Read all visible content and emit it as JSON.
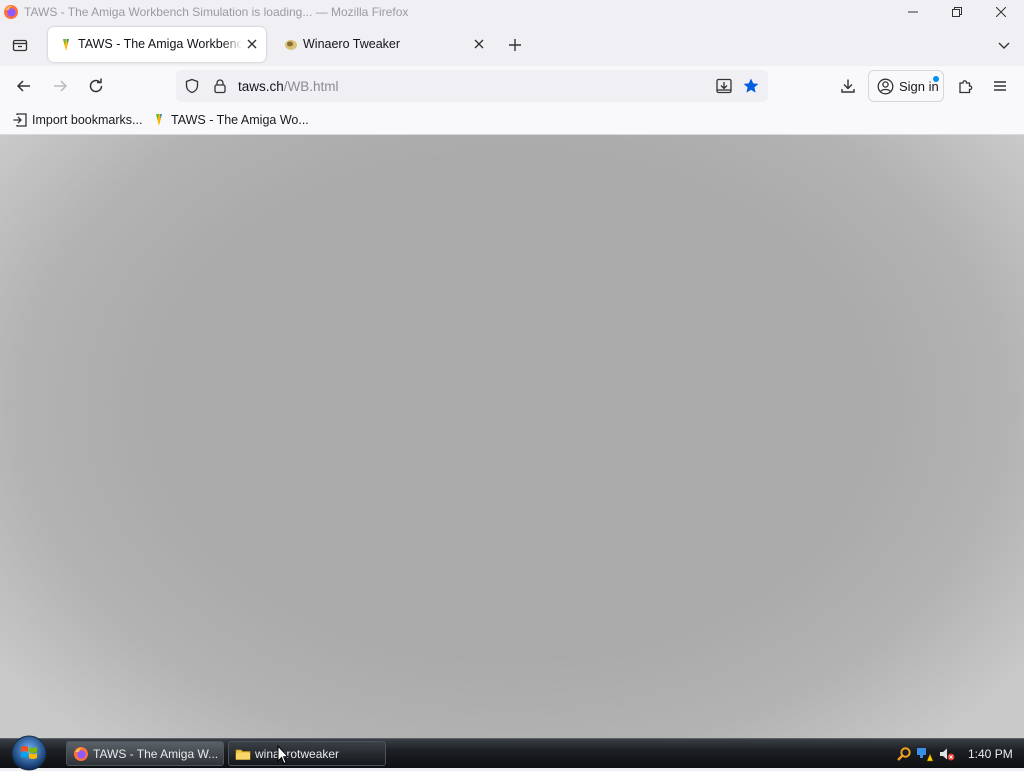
{
  "window": {
    "title": "TAWS - The Amiga Workbench Simulation is loading... — Mozilla Firefox"
  },
  "tabs": [
    {
      "label": "TAWS - The Amiga Workbench Simulation is loading...",
      "active": true,
      "favicon": "taws-favicon"
    },
    {
      "label": "Winaero Tweaker",
      "active": false,
      "favicon": "winaero-favicon"
    }
  ],
  "navbar": {
    "url_host": "taws.ch",
    "url_path": "/WB.html",
    "sign_in_label": "Sign in"
  },
  "bookmarks": [
    {
      "label": "Import bookmarks...",
      "icon": "import-icon"
    },
    {
      "label": "TAWS - The Amiga Wo...",
      "icon": "taws-favicon"
    }
  ],
  "taskbar": {
    "tasks": [
      {
        "label": "TAWS - The Amiga W...",
        "icon": "firefox-icon"
      },
      {
        "label": "winaerotweaker",
        "icon": "folder-icon"
      }
    ],
    "clock": "1:40 PM"
  },
  "colors": {
    "accent": "#0060df",
    "content_bg": "#aaaaaa",
    "sync_dot": "#0090ed"
  }
}
